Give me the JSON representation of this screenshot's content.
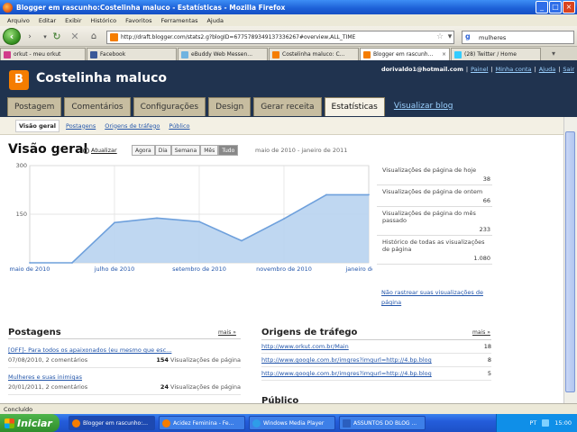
{
  "window": {
    "title": "Blogger em rascunho:Costelinha maluco - Estatísticas - Mozilla Firefox"
  },
  "menu": [
    "Arquivo",
    "Editar",
    "Exibir",
    "Histórico",
    "Favoritos",
    "Ferramentas",
    "Ajuda"
  ],
  "nav": {
    "url": "http://draft.blogger.com/stats2.g?blogID=6775789349137336267#overview,ALL_TIME",
    "search_value": "mulheres"
  },
  "tabs": [
    {
      "label": "orkut - meu orkut",
      "color": "#d13b8a"
    },
    {
      "label": "Facebook",
      "color": "#3b5998"
    },
    {
      "label": "eBuddy Web Messen...",
      "color": "#6fb3e0"
    },
    {
      "label": "Costelinha maluco: C...",
      "color": "#f57d00"
    },
    {
      "label": "Blogger em rascunh...",
      "color": "#f57d00",
      "active": true
    },
    {
      "label": "(28) Twitter / Home",
      "color": "#33ccff"
    }
  ],
  "blog": {
    "icon_letter": "B",
    "title": "Costelinha maluco"
  },
  "user": {
    "email": "dorivaldo1@hotmail.com",
    "links": [
      "Painel",
      "Minha conta",
      "Ajuda",
      "Sair"
    ]
  },
  "main_tabs": [
    "Postagem",
    "Comentários",
    "Configurações",
    "Design",
    "Gerar receita",
    "Estatísticas",
    "Visualizar blog"
  ],
  "sub_tabs": [
    "Visão geral",
    "Postagens",
    "Origens de tráfego",
    "Público"
  ],
  "overview": {
    "title": "Visão geral",
    "refresh_label": "Atualizar",
    "ranges": [
      "Agora",
      "Dia",
      "Semana",
      "Mês",
      "Tudo"
    ],
    "date_range": "maio de 2010 - janeiro de 2011"
  },
  "chart_data": {
    "type": "area",
    "x": [
      "maio de 2010",
      "junho de 2010",
      "julho de 2010",
      "agosto de 2010",
      "setembro de 2010",
      "outubro de 2010",
      "novembro de 2010",
      "dezembro de 2010",
      "janeiro de 2011"
    ],
    "x_tick_labels": [
      "maio de 2010",
      "julho de 2010",
      "setembro de 2010",
      "novembro de 2010",
      "janeiro de 2011"
    ],
    "values": [
      0,
      0,
      124,
      138,
      127,
      68,
      136,
      210,
      210
    ],
    "ylim": [
      0,
      300
    ],
    "yticks": [
      "300",
      "150"
    ],
    "grid": true,
    "fill_color": "#b8d3f0",
    "line_color": "#6ea0dc"
  },
  "stats": [
    {
      "label": "Visualizações de página de hoje",
      "value": "38"
    },
    {
      "label": "Visualizações de página de ontem",
      "value": "66"
    },
    {
      "label": "Visualizações de página do mês passado",
      "value": "233"
    },
    {
      "label": "Histórico de todas as visualizações de página",
      "value": "1.080"
    }
  ],
  "no_track_link": "Não rastrear suas visualizações de página",
  "posts": {
    "title": "Postagens",
    "more": "mais »",
    "items": [
      {
        "title": "[OFF]- Para todos os apaixonados (eu mesmo que esc...",
        "meta": "07/08/2010, 2 comentários",
        "count": "154",
        "unit": "Visualizações de página"
      },
      {
        "title": "Mulheres e suas inimigas",
        "meta": "20/01/2011, 2 comentários",
        "count": "24",
        "unit": "Visualizações de página"
      }
    ]
  },
  "traffic": {
    "title": "Origens de tráfego",
    "more": "mais »",
    "items": [
      {
        "url": "http://www.orkut.com.br/Main",
        "count": "18"
      },
      {
        "url": "http://www.google.com.br/imgres?imgurl=http://4.bp.blog",
        "count": "8"
      },
      {
        "url": "http://www.google.com.br/imgres?imgurl=http://4.bp.blog",
        "count": "5"
      }
    ],
    "next_section": "Público"
  },
  "status": "Concluído",
  "taskbar": {
    "start": "Iniciar",
    "tasks": [
      {
        "label": "Blogger em rascunho:...",
        "color": "#f57d00",
        "active": true
      },
      {
        "label": "Acidez Feminina - Fe...",
        "color": "#f57d00"
      },
      {
        "label": "Windows Media Player",
        "color": "#2e9de8"
      },
      {
        "label": "ASSUNTOS DO BLOG ...",
        "color": "#2b5fbf"
      }
    ],
    "lang": "PT",
    "clock": "15:00"
  }
}
